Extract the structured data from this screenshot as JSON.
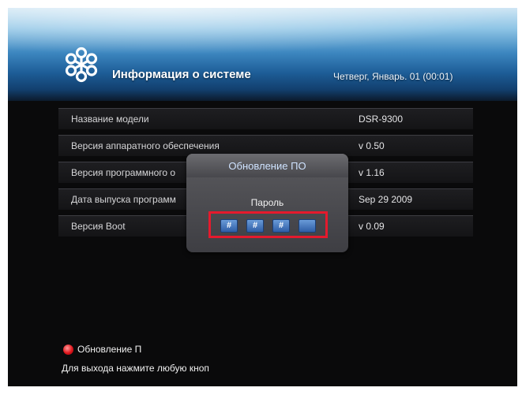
{
  "header": {
    "title": "Информация о системе",
    "datetime": "Четверг, Январь. 01 (00:01)",
    "logo_icon": "snowflake-icon"
  },
  "info_rows": [
    {
      "label": "Название модели",
      "value": "DSR-9300"
    },
    {
      "label": "Версия аппаратного обеспечения",
      "value": "v 0.50"
    },
    {
      "label": "Версия программного о",
      "value": "v 1.16"
    },
    {
      "label": "Дата выпуска программ",
      "value": "Sep 29 2009"
    },
    {
      "label": "Версия Boot",
      "value": "v 0.09"
    }
  ],
  "dialog": {
    "title": "Обновление ПО",
    "label": "Пароль",
    "pin_digits": [
      "#",
      "#",
      "#",
      ""
    ],
    "highlight_color": "#e51a2d"
  },
  "footer": {
    "action_label": "Обновление П",
    "action_color": "#e0161c",
    "hint": "Для выхода нажмите любую кноп"
  }
}
